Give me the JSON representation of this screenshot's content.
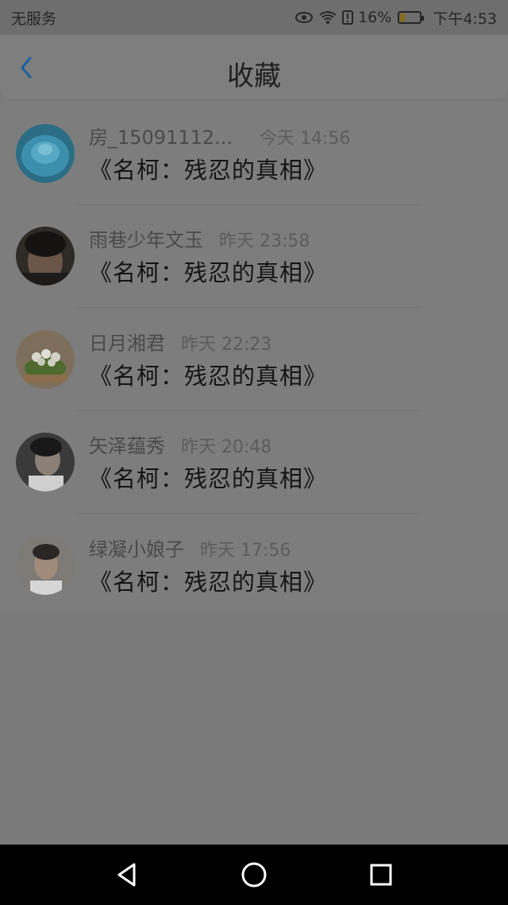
{
  "status_bar": {
    "carrier": "无服务",
    "battery_percent": "16%",
    "time": "下午4:53",
    "icons": [
      "eye-icon",
      "wifi-icon",
      "alert-icon",
      "battery-icon"
    ],
    "battery_level": 0.16
  },
  "header": {
    "title": "收藏",
    "back_icon": "chevron-left-icon"
  },
  "favorites": [
    {
      "author": "房_15091112...",
      "time": "今天 14:56",
      "book": "《名柯：残忍的真相》"
    },
    {
      "author": "雨巷少年文玉",
      "time": "昨天 23:58",
      "book": "《名柯：残忍的真相》"
    },
    {
      "author": "日月湘君",
      "time": "昨天 22:23",
      "book": "《名柯：残忍的真相》"
    },
    {
      "author": "矢泽蕴秀",
      "time": "昨天 20:48",
      "book": "《名柯：残忍的真相》"
    },
    {
      "author": "绿凝小娘子",
      "time": "昨天 17:56",
      "book": "《名柯：残忍的真相》"
    }
  ],
  "nav_bar": {
    "buttons": [
      "back-triangle-icon",
      "home-circle-icon",
      "recents-square-icon"
    ]
  }
}
